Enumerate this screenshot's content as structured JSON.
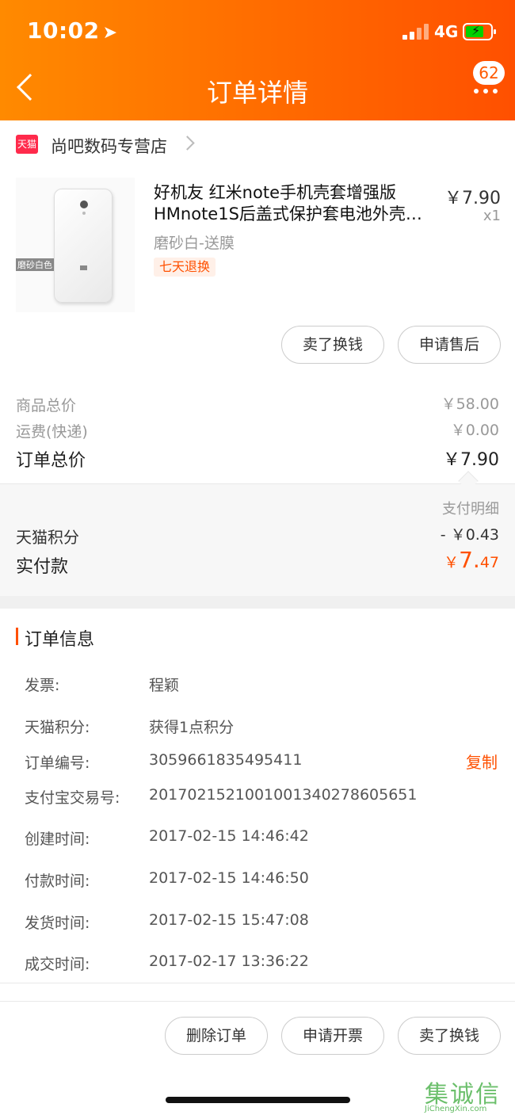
{
  "status_bar": {
    "time": "10:02",
    "network": "4G"
  },
  "nav": {
    "title": "订单详情",
    "badge": "62"
  },
  "store": {
    "icon_label": "天猫",
    "name": "尚吧数码专营店"
  },
  "product": {
    "name": "好机友 红米note手机壳套增强版HMnote1S后盖式保护套电池外壳…",
    "price": "￥7.90",
    "quantity": "x1",
    "sku": "磨砂白-送膜",
    "tag": "七天退换",
    "image_label": "磨砂白色"
  },
  "product_actions": {
    "sell": "卖了换钱",
    "after_sale": "申请售后"
  },
  "summary": {
    "goods_total_label": "商品总价",
    "goods_total_value": "￥58.00",
    "shipping_label": "运费(快递)",
    "shipping_value": "￥0.00",
    "order_total_label": "订单总价",
    "order_total_value": "￥7.90"
  },
  "payment": {
    "detail_label": "支付明细",
    "points_label": "天猫积分",
    "points_value": "- ￥0.43",
    "paid_label": "实付款",
    "paid_currency": "￥",
    "paid_int": "7.",
    "paid_dec": "47"
  },
  "order_info": {
    "title": "订单信息",
    "copy_label": "复制",
    "rows": [
      {
        "label": "发票:",
        "value": "程颖"
      },
      {
        "label": "天猫积分:",
        "value": "获得1点积分"
      },
      {
        "label": "订单编号:",
        "value": "3059661835495411"
      },
      {
        "label": "支付宝交易号:",
        "value": "2017021521001001340278605651"
      },
      {
        "label": "创建时间:",
        "value": "2017-02-15 14:46:42"
      },
      {
        "label": "付款时间:",
        "value": "2017-02-15 14:46:50"
      },
      {
        "label": "发货时间:",
        "value": "2017-02-15 15:47:08"
      },
      {
        "label": "成交时间:",
        "value": "2017-02-17 13:36:22"
      }
    ]
  },
  "bottom_actions": {
    "delete": "删除订单",
    "invoice": "申请开票",
    "sell": "卖了换钱"
  },
  "watermark": {
    "main": "集诚信",
    "url": "JiChengXin.com"
  },
  "colors": {
    "accent": "#ff5000",
    "header_start": "#ff8a00",
    "header_end": "#ff5000"
  }
}
